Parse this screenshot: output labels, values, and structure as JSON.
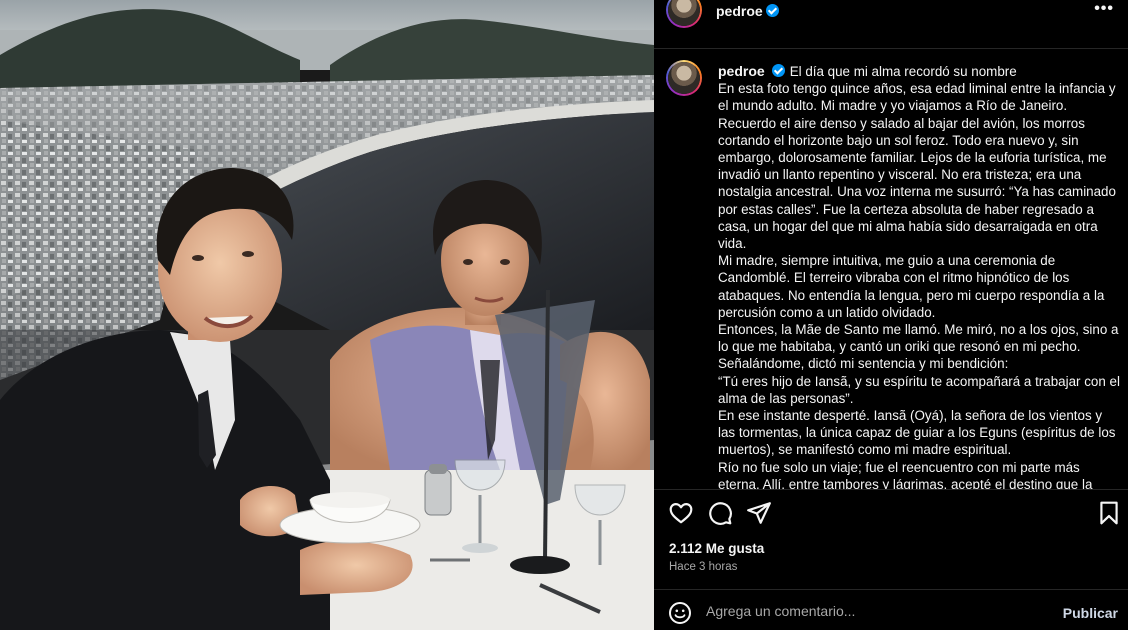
{
  "post": {
    "username": "pedroe",
    "verified": true,
    "more_label": "•••"
  },
  "caption": {
    "username": "pedroe",
    "title": "El día que mi alma recordó su nombre",
    "paragraphs": [
      "En esta foto tengo quince años, esa edad liminal entre la infancia y el mundo adulto. Mi madre y yo viajamos a Río de Janeiro. Recuerdo el aire denso y salado al bajar del avión, los morros cortando el horizonte bajo un sol feroz. Todo era nuevo y, sin embargo, dolorosamente familiar. Lejos de la euforia turística, me invadió un llanto repentino y visceral. No era tristeza; era una nostalgia ancestral. Una voz interna me susurró: “Ya has caminado por estas calles”. Fue la certeza absoluta de haber regresado a casa, un hogar del que mi alma había sido desarraigada en otra vida.",
      "Mi madre, siempre intuitiva, me guio a una ceremonia de Candomblé. El terreiro vibraba con el ritmo hipnótico de los atabaques. No entendía la lengua, pero mi cuerpo respondía a la percusión como a un latido olvidado.",
      "Entonces, la Mãe de Santo me llamó. Me miró, no a los ojos, sino a lo que me habitaba, y cantó un oriki que resonó en mi pecho.",
      "Señalándome, dictó mi sentencia y mi bendición:",
      "“Tú eres hijo de Iansã, y su espíritu te acompañará a trabajar con el alma de las personas”.",
      "En ese instante desperté. Iansã (Oyá), la señora de los vientos y las tormentas, la única capaz de guiar a los Eguns (espíritus de los muertos), se manifestó como mi madre espiritual.",
      "Río no fue solo un viaje; fue el reencuentro con mi parte más eterna. Allí, entre tambores y lágrimas, acepté el destino que la vida había tejido para mí."
    ]
  },
  "actions": {
    "like_icon": "heart-icon",
    "comment_icon": "comment-bubble-icon",
    "share_icon": "paper-plane-icon",
    "save_icon": "bookmark-icon"
  },
  "likes_text": "2.112 Me gusta",
  "time_text": "Hace 3 horas",
  "comment": {
    "placeholder": "Agrega un comentario...",
    "post_label": "Publicar",
    "emoji_icon": "smiley-icon"
  },
  "colors": {
    "background": "#000000",
    "verified": "#0095f6",
    "muted_text": "#a8a8a8",
    "divider": "#262626"
  }
}
